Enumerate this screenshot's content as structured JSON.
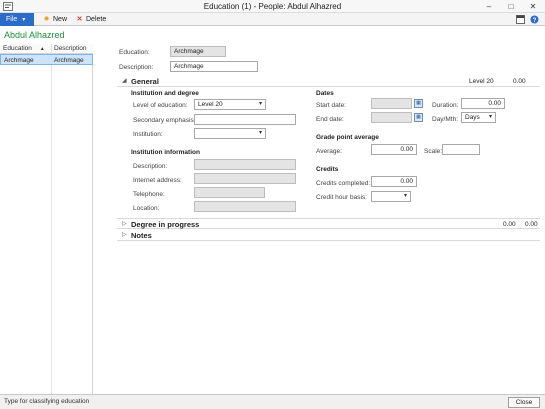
{
  "window": {
    "title": "Education (1) - People: Abdul Alhazred",
    "minimize": "–",
    "maximize": "□",
    "close": "✕"
  },
  "ribbon": {
    "file": "File",
    "file_caret": "▾",
    "new": "New",
    "delete": "Delete",
    "new_icon": "✹",
    "delete_icon": "✕",
    "icons": [
      "layout-icon",
      "help-icon"
    ]
  },
  "record_title": "Abdul Alhazred",
  "grid": {
    "columns": [
      "Education",
      "Description"
    ],
    "sort_indicator": "▲",
    "rows": [
      {
        "education": "Archmage",
        "description": "Archmage"
      }
    ]
  },
  "header_fields": {
    "education_label": "Education:",
    "education_value": "Archmage",
    "description_label": "Description:",
    "description_value": "Archmage"
  },
  "general": {
    "caret": "◢",
    "title": "General",
    "summary_level": "Level 20",
    "summary_value": "0.00",
    "institution_section": "Institution and degree",
    "level_label": "Level of education:",
    "level_value": "Level 20",
    "secondary_label": "Secondary emphasis:",
    "secondary_value": "",
    "institution_label": "Institution:",
    "institution_value": "",
    "inst_info_section": "Institution information",
    "inst_description_label": "Description:",
    "internet_label": "Internet address:",
    "telephone_label": "Telephone:",
    "location_label": "Location:",
    "dates_section": "Dates",
    "start_label": "Start date:",
    "end_label": "End date:",
    "duration_label": "Duration:",
    "duration_value": "0.00",
    "daymth_label": "Day/Mth:",
    "daymth_value": "Days",
    "gpa_section": "Grade point average",
    "average_label": "Average:",
    "average_value": "0.00",
    "scale_label": "Scale:",
    "scale_value": "",
    "credits_section": "Credits",
    "credits_completed_label": "Credits completed:",
    "credits_completed_value": "0.00",
    "credit_hour_label": "Credit hour basis:",
    "credit_hour_value": ""
  },
  "degree": {
    "caret": "▷",
    "title": "Degree in progress",
    "value1": "0.00",
    "value2": "0.00"
  },
  "notes": {
    "caret": "▷",
    "title": "Notes"
  },
  "status": {
    "text": "Type for classifying education",
    "close_label": "Close"
  },
  "colors": {
    "accent": "#2a6cc7",
    "record_title": "#1f8f3a",
    "selected_row": "#cde3f7"
  }
}
